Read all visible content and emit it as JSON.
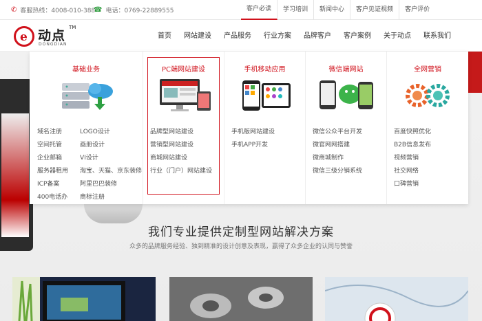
{
  "topbar": {
    "hotline_label": "客服热线：4008-010-388",
    "phone_label": "电话：0769-22889555",
    "links": [
      "客户必读",
      "学习培训",
      "新闻中心",
      "客户见证视频",
      "客户评价"
    ]
  },
  "logo": {
    "mark": "e",
    "cn": "动点",
    "tm": "TM",
    "en": "DONGDIAN"
  },
  "nav": [
    "首页",
    "网站建设",
    "产品服务",
    "行业方案",
    "品牌客户",
    "客户案例",
    "关于动点",
    "联系我们"
  ],
  "mega": [
    {
      "title": "基础业务",
      "links": [
        "域名注册",
        "空间托管",
        "企业邮箱",
        "服务器租用",
        "ICP备案",
        "400电话办"
      ],
      "links2": [
        "LOGO设计",
        "画册设计",
        "VI设计",
        "淘宝、天猫、京东装修",
        "阿里巴巴装修",
        "商标注册"
      ]
    },
    {
      "title": "PC端网站建设",
      "links": [
        "品牌型网站建设",
        "营销型网站建设",
        "商城网站建设",
        "行业（门户）网站建设"
      ]
    },
    {
      "title": "手机移动应用",
      "links": [
        "手机版网站建设",
        "手机APP开发"
      ]
    },
    {
      "title": "微信端网站",
      "links": [
        "微信公众平台开发",
        "微官网网搭建",
        "微商城制作",
        "微信三级分销系统"
      ]
    },
    {
      "title": "全网营销",
      "links": [
        "百度快照优化",
        "B2B信息发布",
        "视频营销",
        "社交网络",
        "口碑营销"
      ]
    }
  ],
  "section": {
    "title": "我们专业提供定制型网站解决方案",
    "subtitle": "众多的品牌服务经验、独到精准的设计创意及表现，赢得了众多企业的认同与赞誉"
  },
  "colors": {
    "brand": "#d0111b"
  }
}
